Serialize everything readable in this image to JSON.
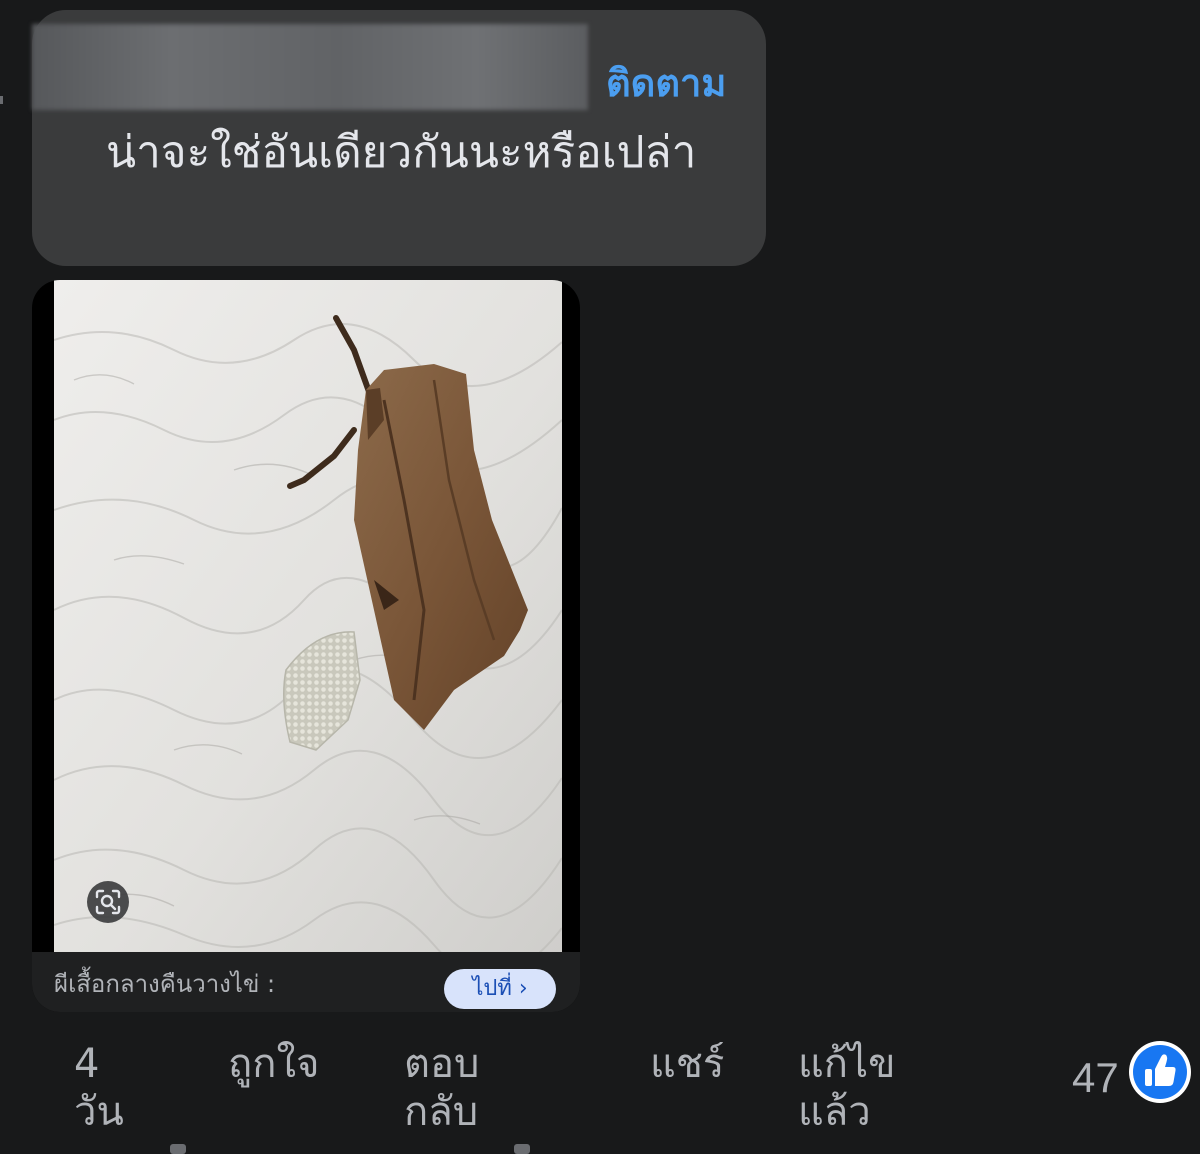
{
  "comment": {
    "author_name_redacted": true,
    "follow_label": "ติดตาม",
    "text": "น่าจะใช่อันเดียวกันนะหรือเปล่า"
  },
  "link_preview": {
    "image_alt": "ผีเสื้อกลางคืนวางไข่",
    "title": "ผีเสื้อกลางคืนวางไข่ :",
    "visit_label": "ไปที่ ›",
    "lens_icon": "image-search-icon"
  },
  "actions": {
    "time": "4 วัน",
    "like": "ถูกใจ",
    "reply": "ตอบกลับ",
    "share": "แชร์",
    "edited": "แก้ไขแล้ว"
  },
  "reactions": {
    "count": "47",
    "icon": "thumbs-up-icon",
    "badge_color": "#1877f2"
  },
  "colors": {
    "background": "#18191a",
    "bubble": "#3a3b3c",
    "link": "#4b9ef0",
    "secondary_text": "#b0b3b8"
  }
}
